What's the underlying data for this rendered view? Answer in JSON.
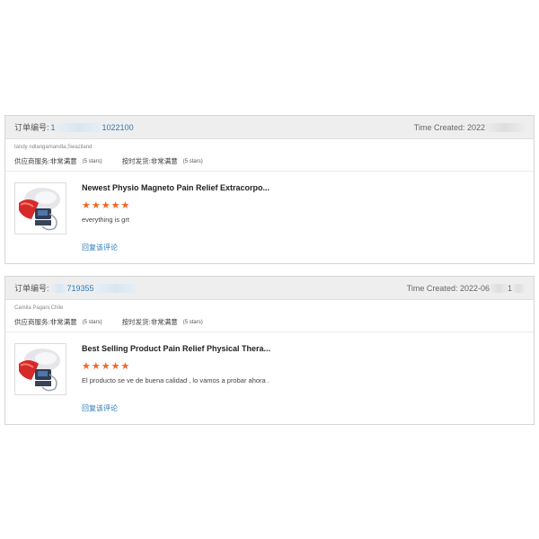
{
  "reviews": [
    {
      "order_label": "订单编号:",
      "order_prefix": "1",
      "order_suffix": "1022100",
      "time_label": "Time Created: 2022",
      "time_suffix": "",
      "buyer": "tandy ndlangamandla,Swaziland",
      "service_label": "供应商服务:",
      "service_value": "非常满意",
      "service_stars": "(5 stars)",
      "shipping_label": "按时发货:",
      "shipping_value": "非常满意",
      "shipping_stars": "(5 stars)",
      "product_title": "Newest Physio Magneto Pain Relief Extracorpo...",
      "stars": 5,
      "review_text": "everything  is grt",
      "reply_label": "回复该评论"
    },
    {
      "order_label": "订单编号:",
      "order_prefix": "",
      "order_suffix": "719355",
      "time_label": "Time Created: 2022-06",
      "time_suffix": "1",
      "buyer": "Camila Pagani,Chile",
      "service_label": "供应商服务:",
      "service_value": "非常满意",
      "service_stars": "(5 stars)",
      "shipping_label": "按时发货:",
      "shipping_value": "非常满意",
      "shipping_stars": "(5 stars)",
      "product_title": "Best Selling Product Pain Relief Physical Thera...",
      "stars": 5,
      "review_text": "El producto se ve de buena calidad , lo vamos a probar ahora .",
      "reply_label": "回复该评论"
    }
  ],
  "colors": {
    "link": "#2a7ab9",
    "star": "#f26522",
    "header_bg": "#eeeeee"
  },
  "icons": {
    "rating_star": "star-icon",
    "thumbnail": "product-thumbnail"
  }
}
